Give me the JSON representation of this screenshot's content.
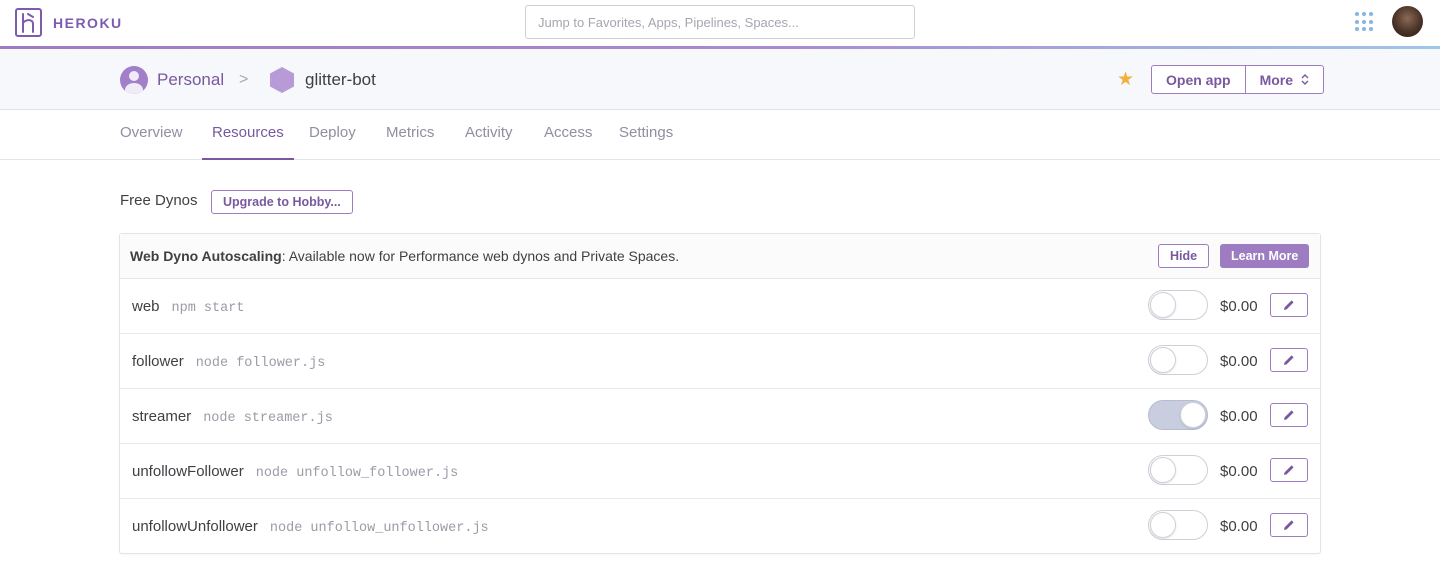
{
  "nav": {
    "brand": "HEROKU",
    "search_placeholder": "Jump to Favorites, Apps, Pipelines, Spaces..."
  },
  "breadcrumb": {
    "owner": "Personal",
    "separator": ">",
    "app": "glitter-bot"
  },
  "actions": {
    "favorite": "★",
    "open_app": "Open app",
    "more": "More"
  },
  "tabs": [
    "Overview",
    "Resources",
    "Deploy",
    "Metrics",
    "Activity",
    "Access",
    "Settings"
  ],
  "active_tab": "Resources",
  "dynos": {
    "label": "Free Dynos",
    "upgrade": "Upgrade to Hobby..."
  },
  "banner": {
    "title": "Web Dyno Autoscaling",
    "text": ": Available now for Performance web dynos and Private Spaces.",
    "hide": "Hide",
    "learn_more": "Learn More"
  },
  "processes": [
    {
      "name": "web",
      "command": "npm start",
      "enabled": false,
      "price": "$0.00"
    },
    {
      "name": "follower",
      "command": "node follower.js",
      "enabled": false,
      "price": "$0.00"
    },
    {
      "name": "streamer",
      "command": "node streamer.js",
      "enabled": true,
      "price": "$0.00"
    },
    {
      "name": "unfollowFollower",
      "command": "node unfollow_follower.js",
      "enabled": false,
      "price": "$0.00"
    },
    {
      "name": "unfollowUnfollower",
      "command": "node unfollow_unfollower.js",
      "enabled": false,
      "price": "$0.00"
    }
  ],
  "colors": {
    "brand_purple": "#79589f",
    "star": "#f0b13f",
    "apps_icon": "#86b5e0"
  }
}
